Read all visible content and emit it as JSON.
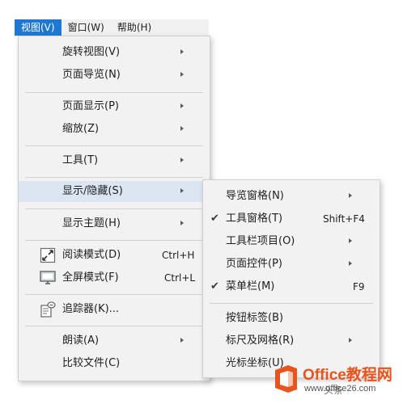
{
  "menubar": {
    "items": [
      "视图(V)",
      "窗口(W)",
      "帮助(H)"
    ]
  },
  "view_menu": {
    "items": [
      {
        "label": "旋转视图(V)"
      },
      {
        "label": "页面导览(N)"
      },
      {
        "label": "页面显示(P)"
      },
      {
        "label": "缩放(Z)"
      },
      {
        "label": "工具(T)"
      },
      {
        "label": "显示/隐藏(S)"
      },
      {
        "label": "显示主题(H)"
      },
      {
        "label": "阅读模式(D)",
        "shortcut": "Ctrl+H",
        "icon": "reading-mode-icon"
      },
      {
        "label": "全屏模式(F)",
        "shortcut": "Ctrl+L",
        "icon": "fullscreen-monitor-icon"
      },
      {
        "label": "追踪器(K)...",
        "icon": "tracker-icon"
      },
      {
        "label": "朗读(A)"
      },
      {
        "label": "比较文件(C)"
      }
    ]
  },
  "show_hide_submenu": {
    "items": [
      {
        "label": "导览窗格(N)"
      },
      {
        "label": "工具窗格(T)",
        "shortcut": "Shift+F4",
        "checked": true
      },
      {
        "label": "工具栏项目(O)"
      },
      {
        "label": "页面控件(P)"
      },
      {
        "label": "菜单栏(M)",
        "shortcut": "F9",
        "checked": true
      },
      {
        "label": "按钮标签(B)"
      },
      {
        "label": "标尺及网格(R)"
      },
      {
        "label": "光标坐标(U)"
      }
    ]
  },
  "watermark": {
    "brand": "Office教程网",
    "url": "www.office26.com",
    "overlay": "头条",
    "brand_color": "#e8541e"
  }
}
